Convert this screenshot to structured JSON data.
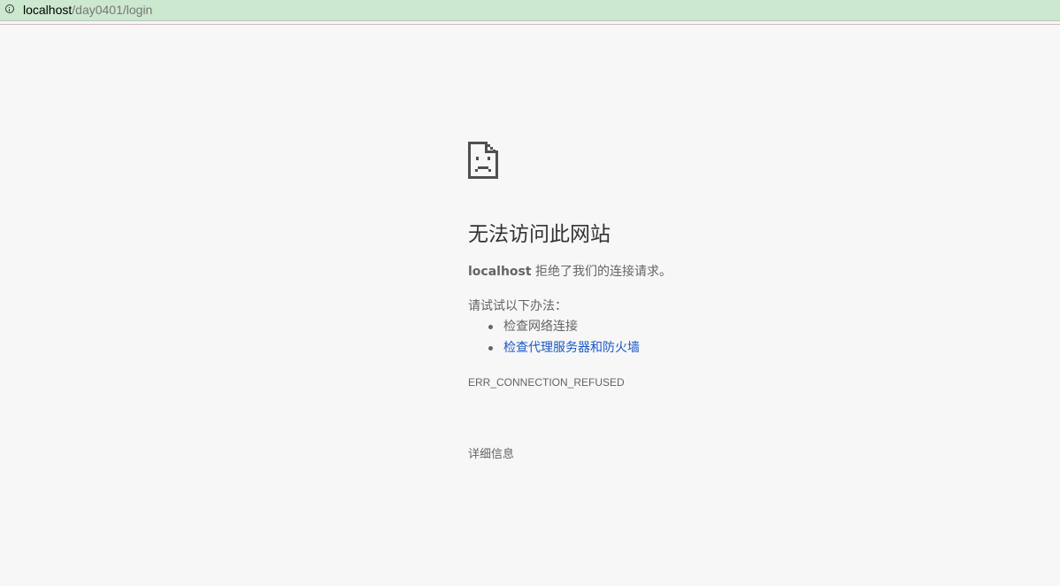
{
  "address_bar": {
    "icon": "info-icon",
    "url_host": "localhost",
    "url_path": "/day0401/login"
  },
  "error_page": {
    "icon": "sad-page-icon",
    "title": "无法访问此网站",
    "host": "localhost",
    "message": " 拒绝了我们的连接请求。",
    "suggestions_heading": "请试试以下办法：",
    "suggestions": [
      {
        "label": "检查网络连接",
        "is_link": false
      },
      {
        "label": "检查代理服务器和防火墙",
        "is_link": true
      }
    ],
    "error_code": "ERR_CONNECTION_REFUSED",
    "details_button": "详细信息"
  },
  "colors": {
    "address_bar_bg": "#cce8cf",
    "page_bg": "#f7f7f7",
    "link": "#1a58c4",
    "text": "#646464",
    "title": "#333333"
  }
}
